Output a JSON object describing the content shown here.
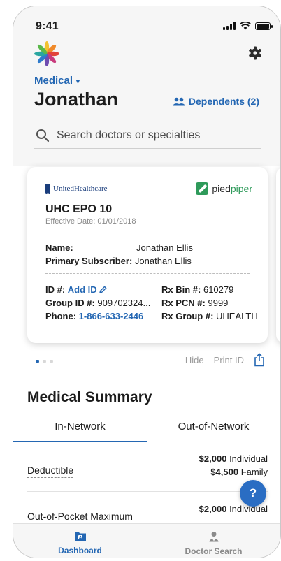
{
  "status_bar": {
    "time": "9:41"
  },
  "header": {
    "plan_type": "Medical",
    "member_name": "Jonathan",
    "dependents_label": "Dependents (2)",
    "icons": {
      "logo": "starburst-logo-icon",
      "settings": "gear-icon",
      "dependents": "people-icon",
      "plan_caret": "chevron-down-icon"
    }
  },
  "search": {
    "placeholder": "Search doctors or specialties",
    "value": "",
    "icon": "search-icon"
  },
  "id_card": {
    "insurer": "UnitedHealthcare",
    "partner_prefix": "pied",
    "partner_suffix": "piper",
    "plan_name": "UHC EPO 10",
    "effective_date": "Effective Date: 01/01/2018",
    "name_label": "Name:",
    "name_value": "Jonathan Ellis",
    "subscriber_label": "Primary Subscriber:",
    "subscriber_value": "Jonathan Ellis",
    "id_label": "ID #:",
    "id_value": "Add ID",
    "group_label": "Group ID #:",
    "group_value": "909702324...",
    "phone_label": "Phone:",
    "phone_value": "1-866-633-2446",
    "rx_bin_label": "Rx Bin #:",
    "rx_bin_value": "610279",
    "rx_pcn_label": "Rx PCN #:",
    "rx_pcn_value": "9999",
    "rx_group_label": "Rx Group #:",
    "rx_group_value": "UHEALTH"
  },
  "card_actions": {
    "hide": "Hide",
    "print": "Print ID",
    "share_icon": "share-icon"
  },
  "carousel": {
    "count": 3,
    "active_index": 0
  },
  "summary": {
    "title": "Medical Summary",
    "tabs": [
      {
        "label": "In-Network",
        "active": true
      },
      {
        "label": "Out-of-Network",
        "active": false
      }
    ],
    "rows": [
      {
        "label": "Deductible",
        "values": [
          {
            "amount": "$2,000",
            "unit": "Individual"
          },
          {
            "amount": "$4,500",
            "unit": "Family"
          }
        ]
      },
      {
        "label": "Out-of-Pocket Maximum",
        "values": [
          {
            "amount": "$2,000",
            "unit": "Individual"
          }
        ]
      }
    ]
  },
  "help_button": {
    "label": "?"
  },
  "bottom_nav": [
    {
      "label": "Dashboard",
      "icon": "id-card-folder-icon",
      "active": true
    },
    {
      "label": "Doctor Search",
      "icon": "doctor-icon",
      "active": false
    }
  ],
  "colors": {
    "accent": "#2467b3",
    "partner_green": "#2e9a5a",
    "insurer_navy": "#1a3d7c"
  }
}
